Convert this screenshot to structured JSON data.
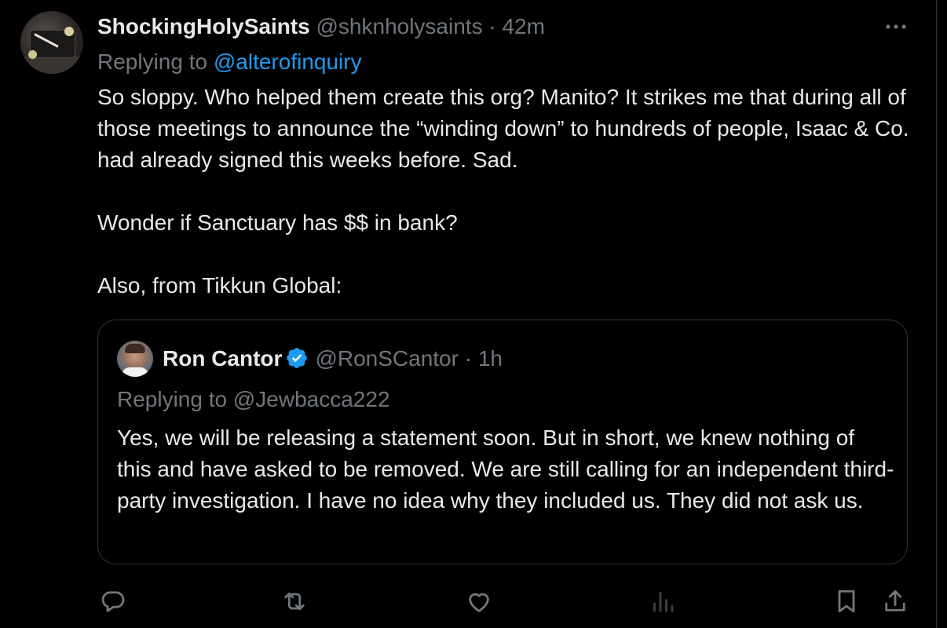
{
  "tweet": {
    "display_name": "ShockingHolySaints",
    "handle": "@shknholysaints",
    "separator": "·",
    "time": "42m",
    "replying_prefix": "Replying to",
    "replying_to": "@alterofinquiry",
    "paragraphs": [
      "So sloppy. Who helped them create this org? Manito? It strikes me that during all of those meetings to announce the “winding down” to hundreds of people, Isaac & Co. had already signed this weeks before. Sad.",
      "Wonder if Sanctuary has $$ in bank?",
      "Also, from Tikkun Global:"
    ]
  },
  "quote": {
    "display_name": "Ron Cantor",
    "verified": true,
    "handle": "@RonSCantor",
    "separator": "·",
    "time": "1h",
    "replying_prefix": "Replying to",
    "replying_to": "@Jewbacca222",
    "text": "Yes, we will be releasing a statement soon. But in short, we knew nothing of this and have asked to be removed. We are still calling for an independent third-party investigation. I have no idea why they included us. They did not ask us."
  },
  "actions": {
    "icons": [
      "reply-icon",
      "retweet-icon",
      "like-icon",
      "views-icon",
      "bookmark-icon",
      "share-icon"
    ]
  },
  "colors": {
    "background": "#000000",
    "text_primary": "#e7e9ea",
    "text_secondary": "#71767b",
    "link": "#1d9bf0",
    "border": "#2f3336",
    "verified_badge": "#1d9bf0"
  }
}
